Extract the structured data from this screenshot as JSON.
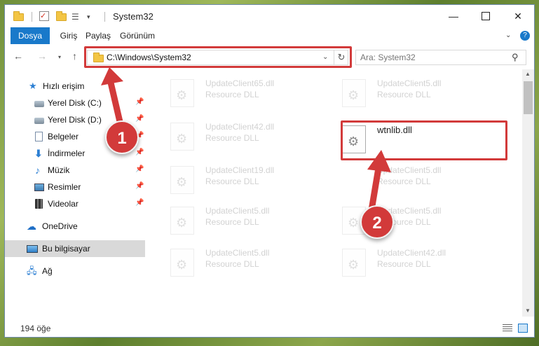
{
  "window": {
    "title": "System32",
    "buttons": {
      "minimize": "—",
      "close": "✕"
    }
  },
  "ribbon": {
    "tabs": [
      "Dosya",
      "Giriş",
      "Paylaş",
      "Görünüm"
    ],
    "toggle_icon": "chevron-down-icon",
    "help_label": "?"
  },
  "navigation": {
    "back": "←",
    "forward": "→",
    "recent": "▾",
    "up": "↑",
    "address": "C:\\Windows\\System32",
    "refresh": "↻",
    "search_placeholder": "Ara: System32"
  },
  "sidebar": {
    "items": [
      {
        "label": "Hızlı erişim",
        "icon": "star-icon"
      },
      {
        "label": "Yerel Disk (C:)",
        "icon": "drive-icon",
        "pinned": true
      },
      {
        "label": "Yerel Disk (D:)",
        "icon": "drive-icon",
        "pinned": true
      },
      {
        "label": "Belgeler",
        "icon": "documents-icon",
        "pinned": true
      },
      {
        "label": "İndirmeler",
        "icon": "download-icon",
        "pinned": true
      },
      {
        "label": "Müzik",
        "icon": "music-icon",
        "pinned": true
      },
      {
        "label": "Resimler",
        "icon": "pictures-icon",
        "pinned": true
      },
      {
        "label": "Videolar",
        "icon": "videos-icon",
        "pinned": true
      },
      {
        "label": "OneDrive",
        "icon": "onedrive-icon"
      },
      {
        "label": "Bu bilgisayar",
        "icon": "this-pc-icon",
        "selected": true
      },
      {
        "label": "Ağ",
        "icon": "network-icon"
      }
    ]
  },
  "files": [
    {
      "name": "UpdateClient65.dll",
      "type": "Resource DLL",
      "faded": true
    },
    {
      "name": "UpdateClient5.dll",
      "type": "Resource DLL",
      "faded": true
    },
    {
      "name": "UpdateClient42.dll",
      "type": "Resource DLL",
      "faded": true
    },
    {
      "name": "wtnlib.dll",
      "type": "",
      "faded": false
    },
    {
      "name": "UpdateClient19.dll",
      "type": "Resource DLL",
      "faded": true
    },
    {
      "name": "UpdateClient5.dll",
      "type": "Resource DLL",
      "faded": true
    },
    {
      "name": "UpdateClient5.dll",
      "type": "Resource DLL",
      "faded": true
    },
    {
      "name": "UpdateClient5.dll",
      "type": "Resource DLL",
      "faded": true
    },
    {
      "name": "UpdateClient5.dll",
      "type": "Resource DLL",
      "faded": true
    },
    {
      "name": "UpdateClient42.dll",
      "type": "Resource DLL",
      "faded": true
    }
  ],
  "status": {
    "item_count": "194 öğe"
  },
  "annotations": {
    "step1": "1",
    "step2": "2",
    "highlight_color": "#d23a3a"
  },
  "colors": {
    "accent": "#1979ca",
    "selection": "#d9d9d9"
  }
}
